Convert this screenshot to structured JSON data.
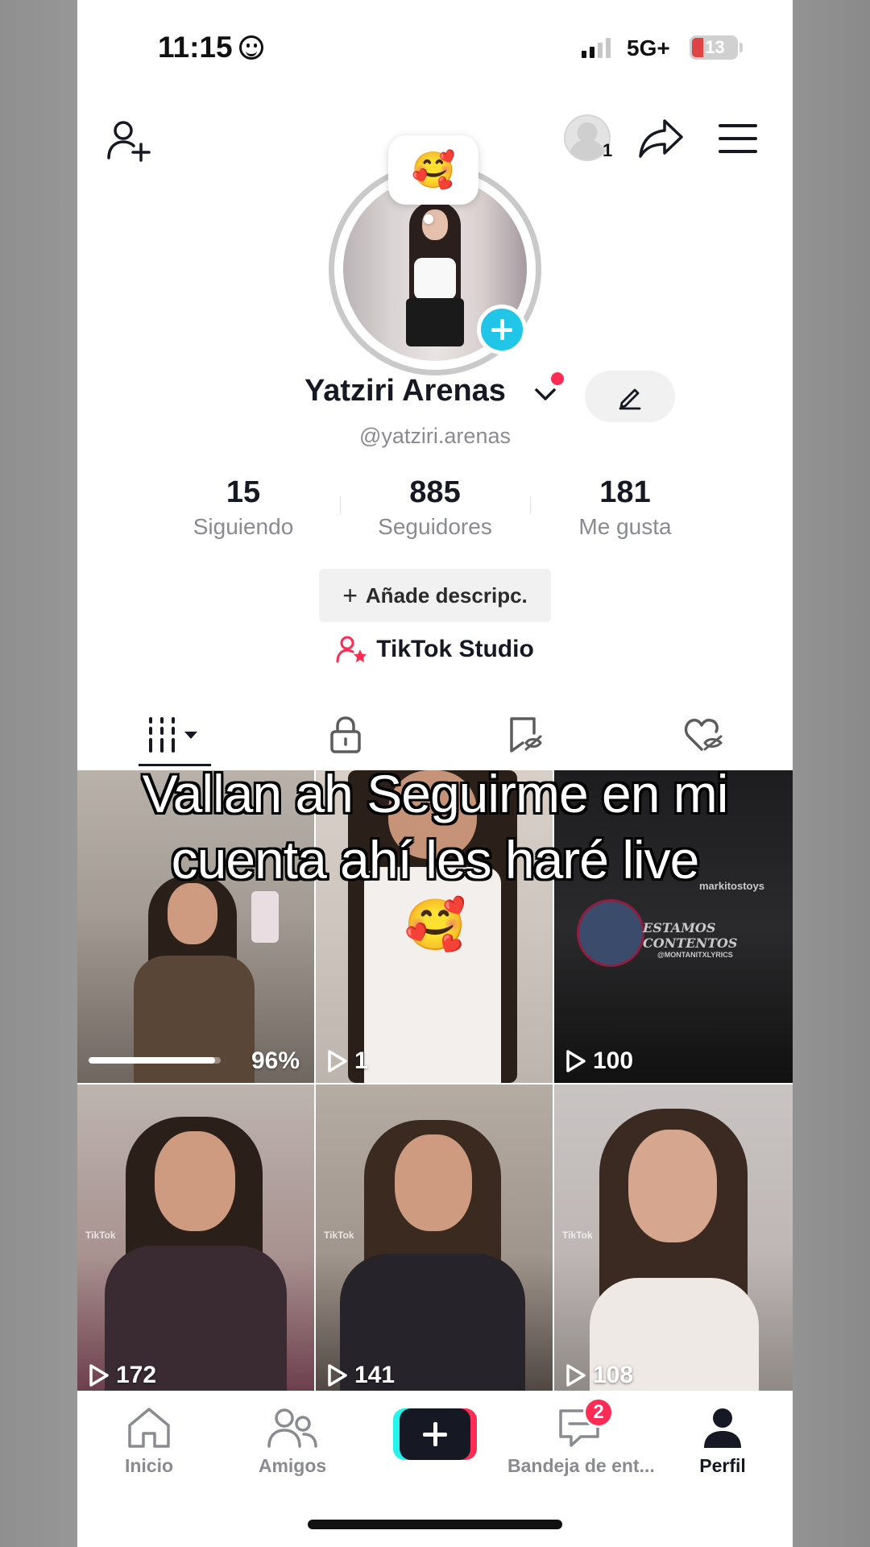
{
  "status_bar": {
    "time": "11:15",
    "network": "5G+",
    "battery": "13",
    "battery_color": "#e04343"
  },
  "top_bar": {
    "add_friend_icon": "person-plus-icon",
    "account_count": "1",
    "share_icon": "share-arrow-icon",
    "menu_icon": "hamburger-menu-icon"
  },
  "profile": {
    "bubble_emoji": "🥰",
    "display_name": "Yatziri Arenas",
    "username": "@yatziri.arenas",
    "stats": [
      {
        "value": "15",
        "label": "Siguiendo"
      },
      {
        "value": "885",
        "label": "Seguidores"
      },
      {
        "value": "181",
        "label": "Me gusta"
      }
    ],
    "add_bio_label": "Añade descripc.",
    "studio_label": "TikTok Studio"
  },
  "tabs": [
    {
      "name": "videos",
      "icon": "grid-icon",
      "active": true
    },
    {
      "name": "private",
      "icon": "lock-icon",
      "active": false
    },
    {
      "name": "favorites",
      "icon": "bookmark-hidden-icon",
      "active": false
    },
    {
      "name": "liked",
      "icon": "heart-hidden-icon",
      "active": false
    }
  ],
  "caption": {
    "line1": "Vallan ah Seguirme en mi",
    "line2": "cuenta ahí les haré live",
    "emoji": "🥰"
  },
  "videos": [
    {
      "views": "",
      "progress_label": "96%",
      "progress": 0.96
    },
    {
      "views": "1"
    },
    {
      "views": "100"
    },
    {
      "views": "172"
    },
    {
      "views": "141"
    },
    {
      "views": "108"
    }
  ],
  "video_overlay_texts": {
    "watermark_user": "markitostoys",
    "watermark_title": "ESTAMOS CONTENTOS",
    "watermark_sub": "@MONTANITXLYRICS",
    "tiktok_mark": "TikTok"
  },
  "nav": [
    {
      "label": "Inicio",
      "icon": "home-icon",
      "active": false
    },
    {
      "label": "Amigos",
      "icon": "friends-icon",
      "active": false
    },
    {
      "label": "",
      "icon": "create-plus-icon",
      "active": false
    },
    {
      "label": "Bandeja de ent...",
      "icon": "inbox-icon",
      "active": false,
      "badge": "2"
    },
    {
      "label": "Perfil",
      "icon": "profile-icon",
      "active": true
    }
  ],
  "colors": {
    "accent_pink": "#fe2c55",
    "accent_cyan": "#25f4ee",
    "plus_badge": "#20c5e8"
  }
}
